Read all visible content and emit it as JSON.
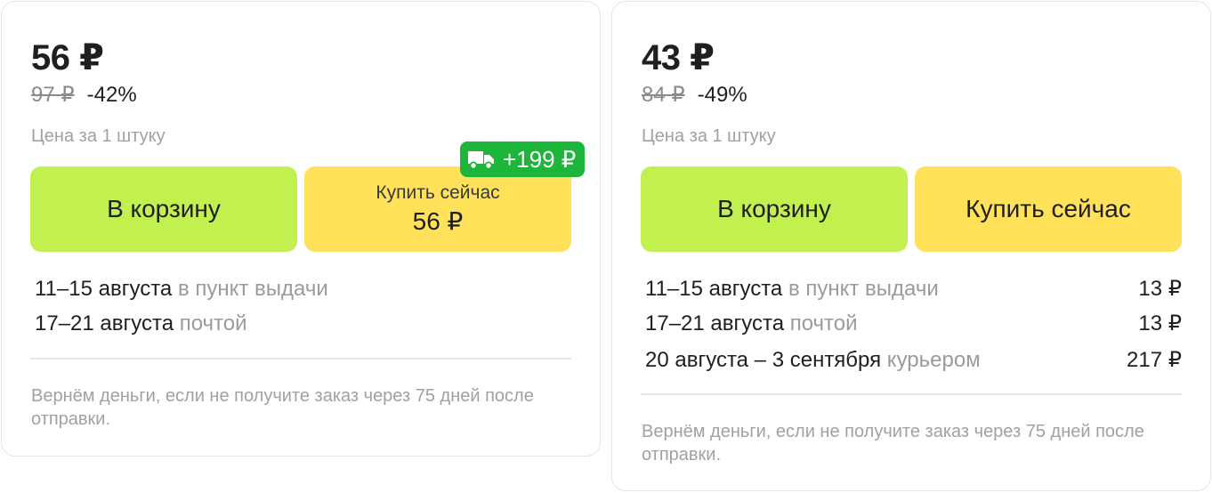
{
  "offers": [
    {
      "price": "56 ₽",
      "old_price": "97 ₽",
      "discount": "-42%",
      "per_unit": "Цена за 1 штуку",
      "cart_button": "В корзину",
      "buy_button": "Купить сейчас",
      "buy_button_price": "56 ₽",
      "delivery_badge": "+199 ₽",
      "deliveries": [
        {
          "date": "11–15 августа",
          "method": "в пункт выдачи"
        },
        {
          "date": "17–21 августа",
          "method": "почтой"
        }
      ],
      "refund_note": "Вернём деньги, если не получите заказ через 75 дней после отправки."
    },
    {
      "price": "43 ₽",
      "old_price": "84 ₽",
      "discount": "-49%",
      "per_unit": "Цена за 1 штуку",
      "cart_button": "В корзину",
      "buy_button": "Купить сейчас",
      "deliveries": [
        {
          "date": "11–15 августа",
          "method": "в пункт выдачи",
          "price": "13 ₽"
        },
        {
          "date": "17–21 августа",
          "method": "почтой",
          "price": "13 ₽"
        },
        {
          "date": "20 августа – 3 сентября",
          "method": "курьером",
          "price": "217 ₽"
        }
      ],
      "refund_note": "Вернём деньги, если не получите заказ через 75 дней после отправки."
    }
  ],
  "colors": {
    "cart_button": "#c2f04f",
    "buy_button": "#ffe15a",
    "badge": "#1db53a"
  },
  "icons": {
    "delivery_badge": "truck-icon"
  }
}
